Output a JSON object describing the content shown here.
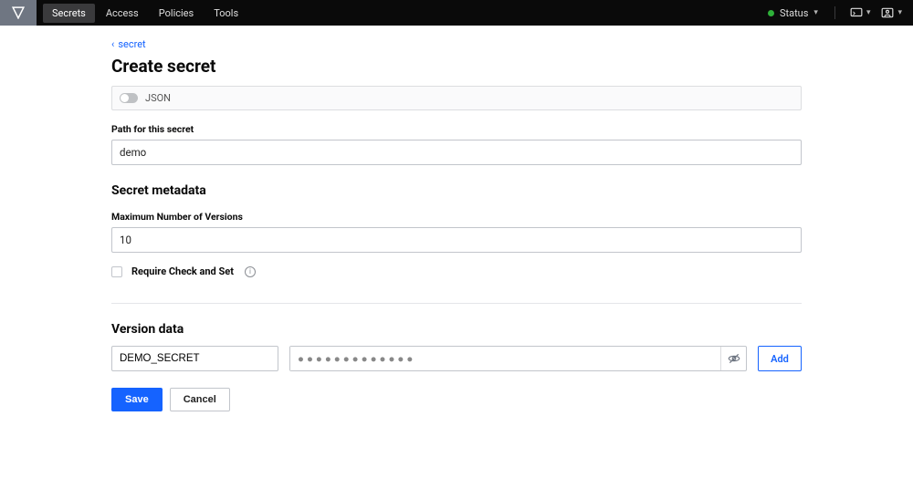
{
  "nav": {
    "items": [
      "Secrets",
      "Access",
      "Policies",
      "Tools"
    ],
    "active_index": 0
  },
  "status": {
    "label": "Status"
  },
  "breadcrumb": {
    "label": "secret"
  },
  "page_title": "Create secret",
  "json_toggle": {
    "label": "JSON",
    "on": false
  },
  "path": {
    "label": "Path for this secret",
    "value": "demo"
  },
  "metadata": {
    "title": "Secret metadata",
    "max_versions": {
      "label": "Maximum Number of Versions",
      "value": "10"
    },
    "require_cas": {
      "label": "Require Check and Set",
      "checked": false
    }
  },
  "version_data": {
    "title": "Version data",
    "rows": [
      {
        "key": "DEMO_SECRET",
        "value_masked": "●●●●●●●●●●●●●"
      }
    ],
    "add_label": "Add"
  },
  "actions": {
    "save": "Save",
    "cancel": "Cancel"
  }
}
